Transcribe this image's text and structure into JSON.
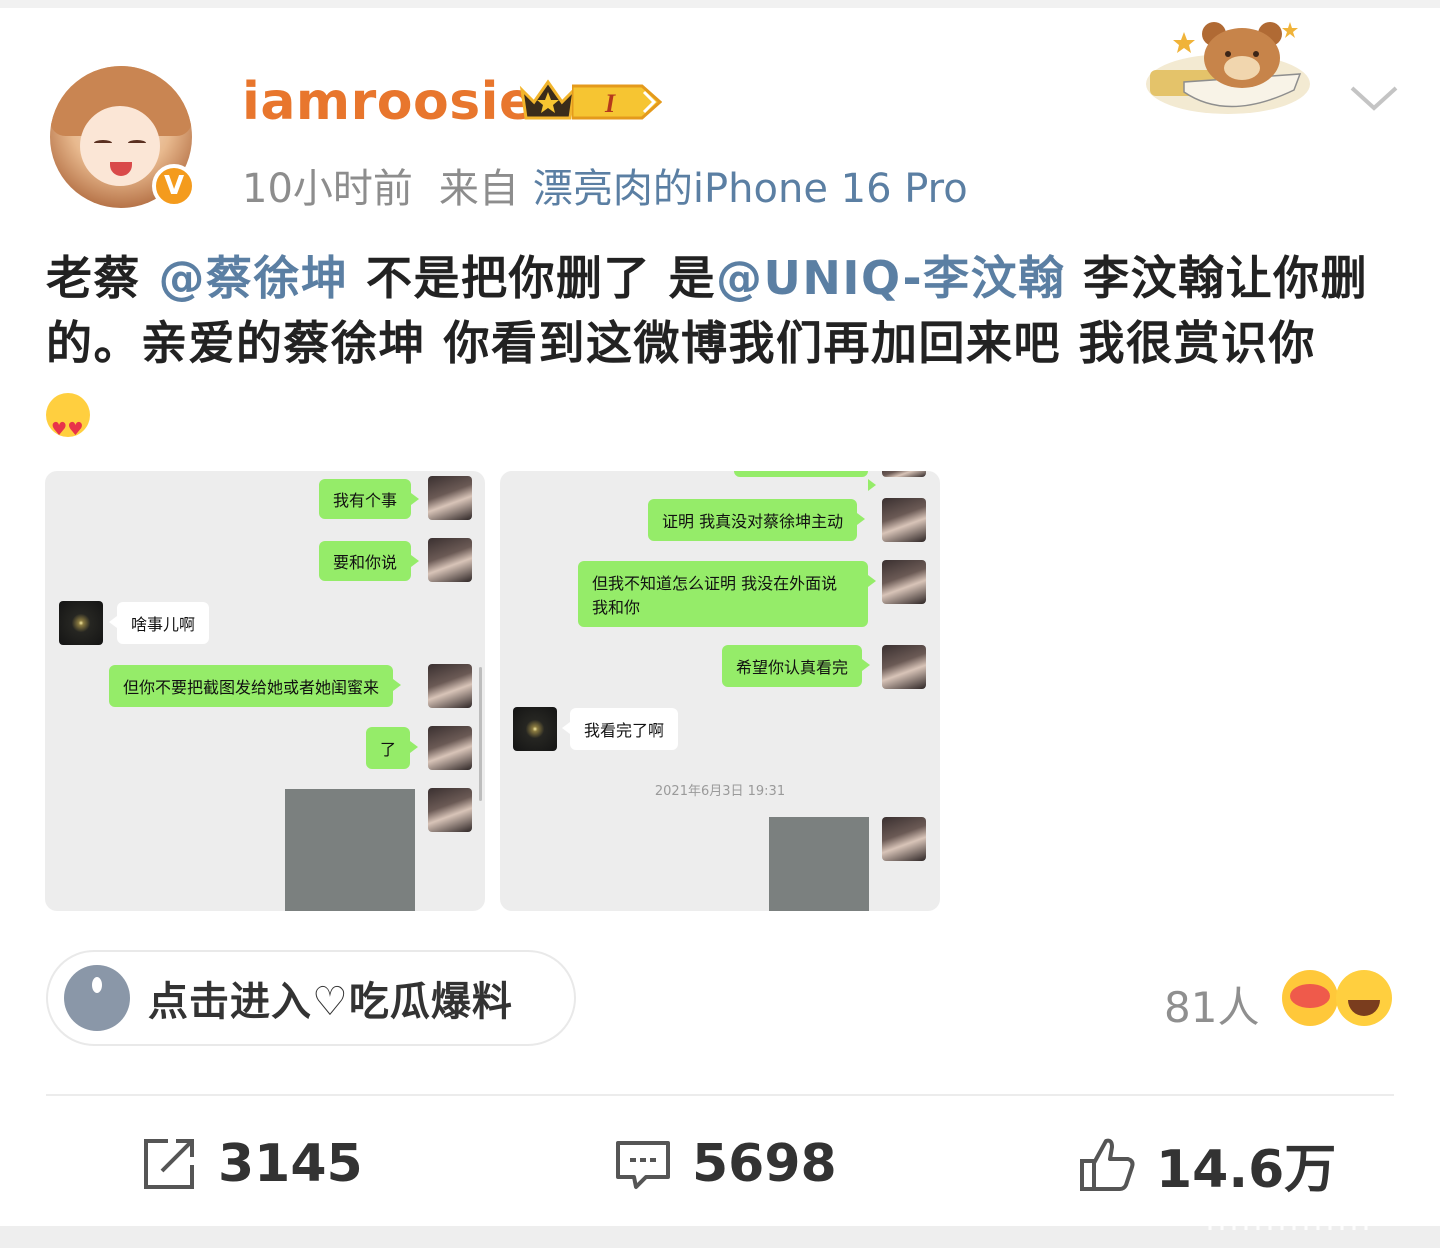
{
  "user": {
    "name": "iamroosie",
    "level": "I",
    "verified_mark": "V"
  },
  "meta": {
    "time": "10小时前",
    "from": "来自",
    "source": "漂亮肉的iPhone 16 Pro"
  },
  "post": {
    "t1": "老蔡 ",
    "m1": "@蔡徐坤",
    "t2": " 不是把你删了 是",
    "m2": "@UNIQ-李汶翰",
    "t3": " 李汶翰让你删的。亲爱的蔡徐坤 你看到这微博我们再加回来吧 我很赏识你",
    "emoji": "heart-eyes-emoji"
  },
  "screenshot1": {
    "messages": [
      {
        "side": "right",
        "text": "我有个事"
      },
      {
        "side": "right",
        "text": "要和你说"
      },
      {
        "side": "left",
        "text": "啥事儿啊"
      },
      {
        "side": "right",
        "text": "但你不要把截图发给她或者她闺蜜来"
      },
      {
        "side": "right",
        "text": "了"
      }
    ]
  },
  "screenshot2": {
    "messages": [
      {
        "side": "right",
        "text": "证明 我真没对蔡徐坤主动"
      },
      {
        "side": "right",
        "text": "但我不知道怎么证明 我没在外面说"
      },
      {
        "side": "right",
        "text": "我和你"
      },
      {
        "side": "right",
        "text": "希望你认真看完"
      },
      {
        "side": "left",
        "text": "我看完了啊"
      }
    ],
    "timestamp": "2021年6月3日 19:31"
  },
  "topic": {
    "label": "点击进入♡吃瓜爆料"
  },
  "reactions": {
    "count_label": "81人"
  },
  "actions": {
    "repost": "3145",
    "comment": "5698",
    "like": "14.6万"
  },
  "colors": {
    "username": "#e8762d",
    "mention": "#5b7fa3",
    "wechat_green": "#95ec69",
    "verified": "#f49b1d"
  }
}
